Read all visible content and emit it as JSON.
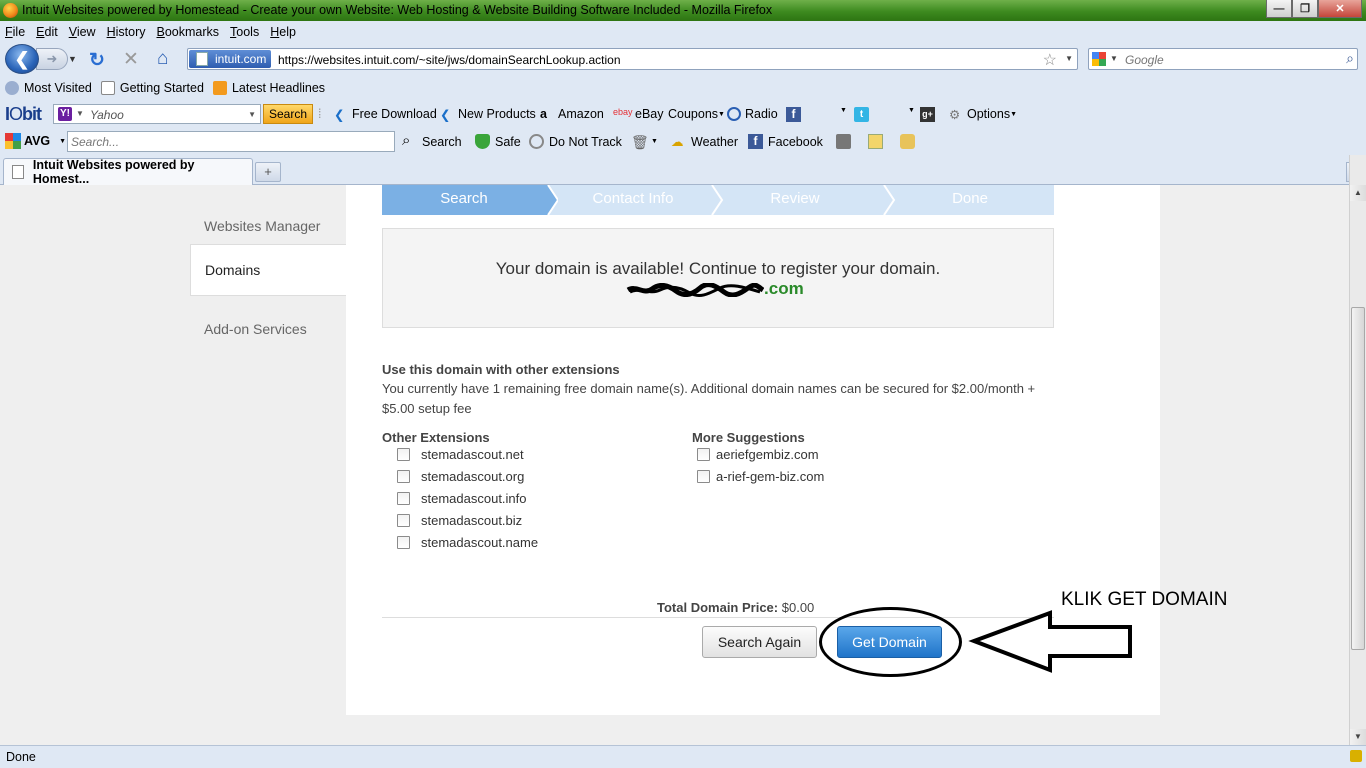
{
  "window": {
    "title": "Intuit Websites powered by Homestead - Create your own Website: Web Hosting & Website Building Software Included - Mozilla Firefox"
  },
  "menu": [
    "File",
    "Edit",
    "View",
    "History",
    "Bookmarks",
    "Tools",
    "Help"
  ],
  "nav": {
    "identity": "intuit.com",
    "url": "https://websites.intuit.com/~site/jws/domainSearchLookup.action",
    "search_placeholder": "Google"
  },
  "bookmarks": [
    "Most Visited",
    "Getting Started",
    "Latest Headlines"
  ],
  "iobit_toolbar": {
    "search_placeholder": "Yahoo",
    "search_button": "Search",
    "items": [
      "Free Download",
      "New Products",
      "Amazon",
      "eBay",
      "Coupons",
      "Radio",
      "Options"
    ]
  },
  "avg_toolbar": {
    "logo": "AVG",
    "search_placeholder": "Search...",
    "items": [
      "Search",
      "Safe",
      "Do Not Track",
      "Weather",
      "Facebook"
    ]
  },
  "tab": {
    "title": "Intuit Websites powered by Homest..."
  },
  "sidebar": {
    "items": [
      {
        "label": "Websites Manager",
        "active": false
      },
      {
        "label": "Domains",
        "active": true
      },
      {
        "label": "Add-on Services",
        "active": false
      }
    ]
  },
  "steps": [
    "Search",
    "Contact Info",
    "Review",
    "Done"
  ],
  "availability": {
    "message": "Your domain is available! Continue to register your domain.",
    "domain_suffix": "com"
  },
  "extensions_section": {
    "title": "Use this domain with other extensions",
    "description": "You currently have 1 remaining free domain name(s). Additional domain names can be secured for $2.00/month + $5.00 setup fee"
  },
  "other_extensions": {
    "title": "Other Extensions",
    "items": [
      "stemadascout.net",
      "stemadascout.org",
      "stemadascout.info",
      "stemadascout.biz",
      "stemadascout.name"
    ]
  },
  "more_suggestions": {
    "title": "More Suggestions",
    "items": [
      "aeriefgembiz.com",
      "a-rief-gem-biz.com"
    ]
  },
  "total": {
    "label": "Total Domain Price:",
    "value": "$0.00"
  },
  "buttons": {
    "search_again": "Search Again",
    "get_domain": "Get Domain"
  },
  "annotation": {
    "text": "KLIK GET DOMAIN"
  },
  "status": {
    "text": "Done"
  },
  "colors": {
    "step_active": "#7bb0e4",
    "step_inactive": "#d4e5f6",
    "get_domain": "#2f86d8",
    "available_domain": "#2a8a2a"
  }
}
